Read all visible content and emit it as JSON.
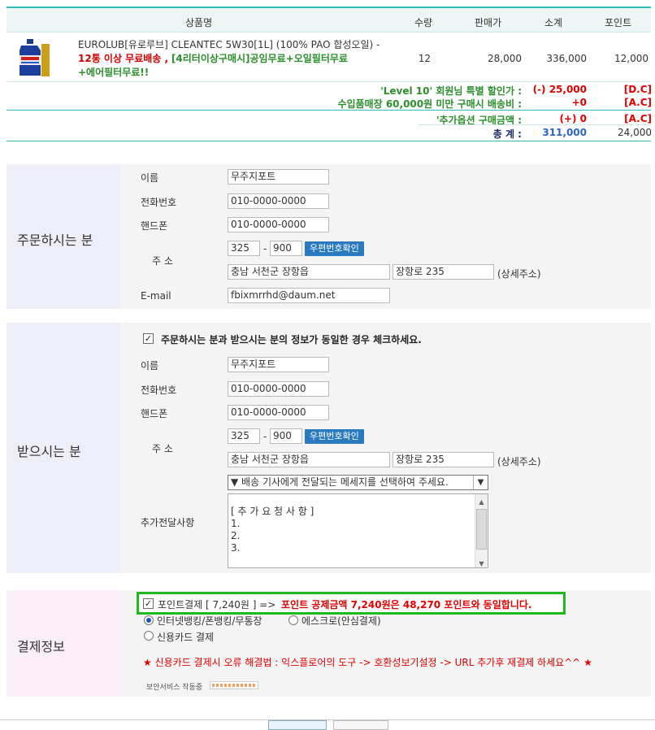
{
  "cart": {
    "headers": {
      "product": "상품명",
      "qty": "수량",
      "price": "판매가",
      "subtotal": "소계",
      "point": "포인트"
    },
    "item": {
      "name": "EUROLUB[유로루브] CLEANTEC 5W30[1L] (100% PAO 합성오일) -",
      "promo_red": "12통 이상 무료배송 ,",
      "promo_green": "[4리터이상구매시]공임무료+오일필터무료",
      "promo_green2": "+에어필터무료!!",
      "qty": "12",
      "price": "28,000",
      "subtotal": "336,000",
      "point": "12,000"
    },
    "discount": {
      "label": "'Level 10' 회원님 특별 할인가 :",
      "value": "(-) 25,000",
      "code": "[D.C]"
    },
    "shipping": {
      "label": "수입품매장 60,000원 미만 구매시 배송비 :",
      "value": "+0",
      "code": "[A.C]"
    },
    "option": {
      "label": "'추가옵션 구매금액 :",
      "value": "(+) 0",
      "code": "[A.C]"
    },
    "total": {
      "label": "총 계 :",
      "value": "311,000",
      "point": "24,000"
    }
  },
  "orderer": {
    "title": "주문하시는 분",
    "name_label": "이름",
    "name": "무주지포트",
    "phone_label": "전화번호",
    "phone": "010-0000-0000",
    "mobile_label": "핸드폰",
    "mobile": "010-0000-0000",
    "address_label": "주 소",
    "zip1": "325",
    "zip_sep": "-",
    "zip2": "900",
    "zip_button": "우편번호확인",
    "addr1": "충남 서천군 장항읍",
    "addr2": "장항로 235",
    "addr_detail": "(상세주소)",
    "email_label": "E-mail",
    "email": "fbixmrrhd@daum.net"
  },
  "receiver": {
    "title": "받으시는 분",
    "same_check": "주문하시는 분과 받으시는 분의 정보가 동일한 경우 체크하세요.",
    "name_label": "이름",
    "name": "무주지포트",
    "phone_label": "전화번호",
    "phone": "010-0000-0000",
    "mobile_label": "핸드폰",
    "mobile": "010-0000-0000",
    "address_label": "주 소",
    "zip1": "325",
    "zip_sep": "-",
    "zip2": "900",
    "zip_button": "우편번호확인",
    "addr1": "충남 서천군 장항읍",
    "addr2": "장항로 235",
    "addr_detail": "(상세주소)",
    "message_select": "▼ 배송 기사에게 전달되는 메세지를 선택하여 주세요.",
    "extra_label": "추가전달사항",
    "extra_lines": [
      "[ 추 가 요 청 사 항 ]",
      "1.",
      "2.",
      "3."
    ]
  },
  "payment": {
    "title": "결제정보",
    "point_label": "포인트결제 [ 7,240원 ] =>",
    "point_note": "포인트 공제금액 7,240원은 48,270 포인트와 동일합니다.",
    "opt_bank": "인터넷뱅킹/폰뱅킹/무통장",
    "opt_escrow": "에스크로(안심결제)",
    "opt_card": "신용카드 결제",
    "card_notice": "★ 신용카드 결제시 오류 해결법 : 익스플로어의 도구 -> 호환성보기설정 -> URL 추가후 재결제 하세요^^ ★",
    "security": "보안서비스 작동중"
  }
}
